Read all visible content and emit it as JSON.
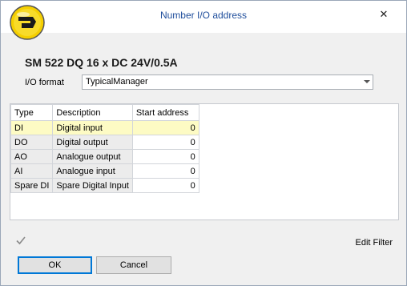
{
  "window": {
    "title": "Number I/O address",
    "close_glyph": "✕"
  },
  "device": {
    "title": "SM 522 DQ 16 x DC 24V/0.5A"
  },
  "io_format": {
    "label": "I/O format",
    "value": "TypicalManager"
  },
  "grid": {
    "headers": [
      "Type",
      "Description",
      "Start address"
    ],
    "rows": [
      {
        "type": "DI",
        "description": "Digital input",
        "start": "0"
      },
      {
        "type": "DO",
        "description": "Digital output",
        "start": "0"
      },
      {
        "type": "AO",
        "description": "Analogue output",
        "start": "0"
      },
      {
        "type": "AI",
        "description": "Analogue input",
        "start": "0"
      },
      {
        "type": "Spare DI",
        "description": "Spare Digital Input",
        "start": "0"
      }
    ],
    "selected_row": 0
  },
  "footer": {
    "edit_filter": "Edit Filter"
  },
  "buttons": {
    "ok": "OK",
    "cancel": "Cancel"
  },
  "colors": {
    "title_text": "#1f4e9c",
    "selected_row": "#fdfbc4",
    "logo_yellow": "#f5cf00"
  }
}
